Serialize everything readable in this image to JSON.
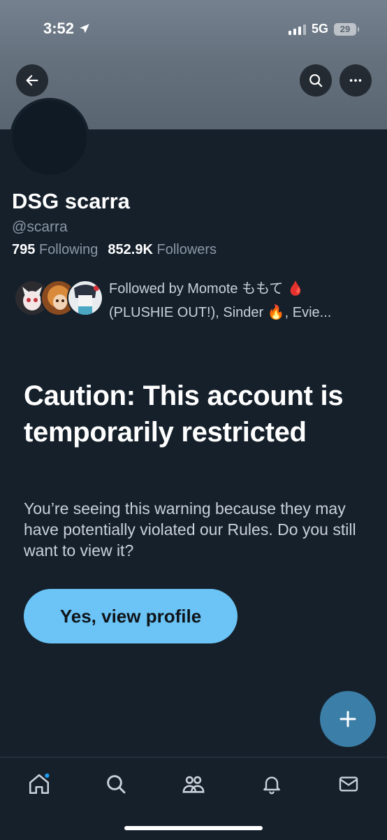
{
  "status_bar": {
    "time": "3:52",
    "network": "5G",
    "battery": "29"
  },
  "header": {
    "back_icon": "arrow-left-icon",
    "search_icon": "search-icon",
    "more_icon": "more-horizontal-icon"
  },
  "profile": {
    "display_name": "DSG scarra",
    "handle": "@scarra",
    "following_count": "795",
    "following_label": "Following",
    "followers_count": "852.9K",
    "followers_label": "Followers",
    "followed_by_line1": "Followed by Momote ももて 🩸",
    "followed_by_line2": "(PLUSHIE OUT!), Sinder 🔥, Evie..."
  },
  "warning": {
    "title": "Caution: This account is temporarily restricted",
    "body": "You’re seeing this warning because they may have potentially violated our Rules. Do you still want to view it?",
    "button_label": "Yes, view profile"
  },
  "fab": {
    "icon": "plus-icon"
  },
  "tabbar": {
    "items": [
      "home-icon",
      "search-icon",
      "communities-icon",
      "notifications-icon",
      "messages-icon"
    ]
  },
  "colors": {
    "background": "#15202b",
    "accent_button": "#6bc4f5",
    "fab": "#3b7ea7"
  }
}
